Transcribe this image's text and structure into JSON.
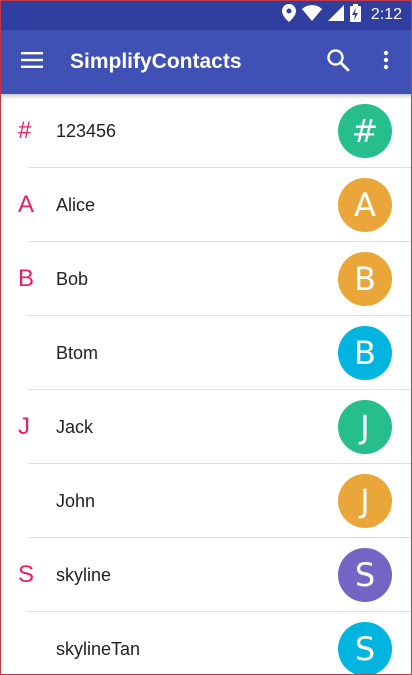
{
  "status_bar": {
    "time": "2:12",
    "background": "#303f9f"
  },
  "app_bar": {
    "title": "SimplifyContacts",
    "background": "#3f51b5",
    "icons": [
      "menu-icon",
      "search-icon",
      "more-vert-icon"
    ]
  },
  "colors": {
    "section_letter": "#e91e63",
    "divider": "#e0e0e0"
  },
  "contacts": [
    {
      "section": "#",
      "name": "123456",
      "initial": "#",
      "avatar_color": "#26bf8c"
    },
    {
      "section": "A",
      "name": "Alice",
      "initial": "A",
      "avatar_color": "#eba63a"
    },
    {
      "section": "B",
      "name": "Bob",
      "initial": "B",
      "avatar_color": "#eba63a"
    },
    {
      "section": "",
      "name": "Btom",
      "initial": "B",
      "avatar_color": "#00b4e0"
    },
    {
      "section": "J",
      "name": "Jack",
      "initial": "J",
      "avatar_color": "#26bf8c"
    },
    {
      "section": "",
      "name": "John",
      "initial": "J",
      "avatar_color": "#eba63a"
    },
    {
      "section": "S",
      "name": "skyline",
      "initial": "S",
      "avatar_color": "#7465c4"
    },
    {
      "section": "",
      "name": "skylineTan",
      "initial": "S",
      "avatar_color": "#00b4e0"
    }
  ]
}
